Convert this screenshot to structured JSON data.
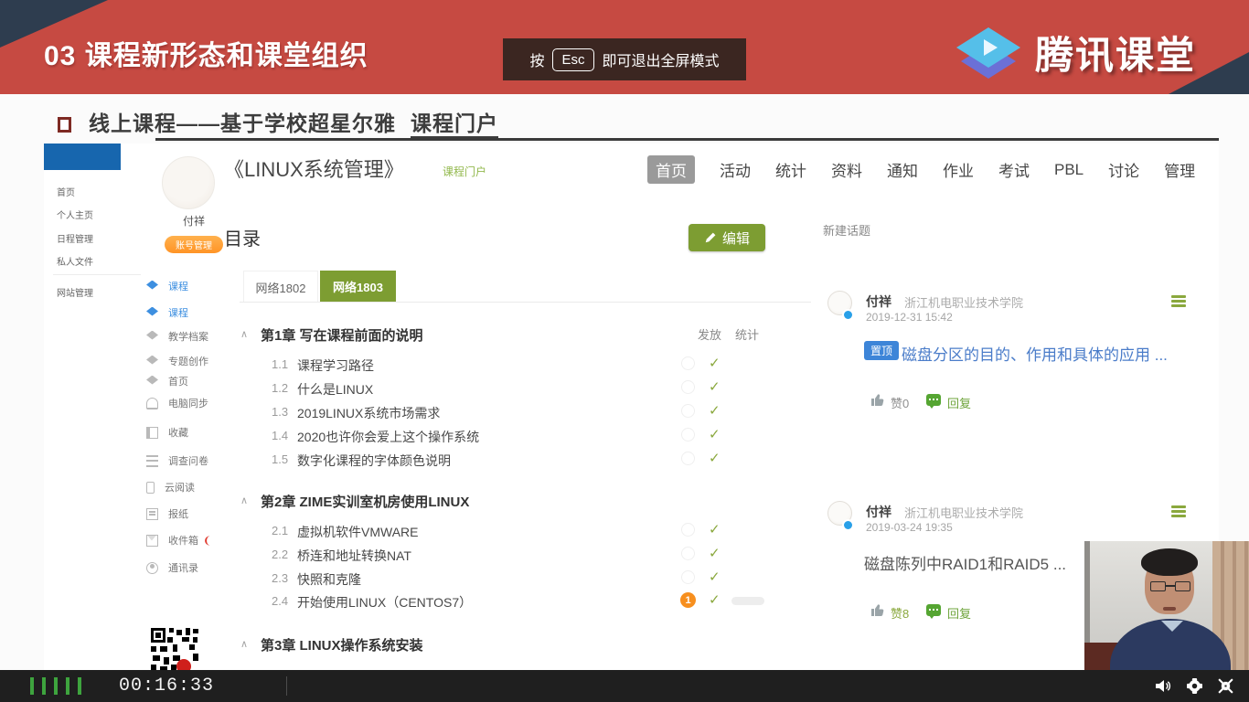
{
  "banner": {
    "title": "03 课程新形态和课堂组织",
    "esc_prefix": "按",
    "esc_key": "Esc",
    "esc_suffix": "即可退出全屏模式",
    "logo_text": "腾讯课堂"
  },
  "slide": {
    "heading": "线上课程——基于学校超星尔雅",
    "heading_link": "课程门户"
  },
  "portal": {
    "primary_nav": [
      "首页",
      "个人主页",
      "日程管理",
      "私人文件",
      "网站管理"
    ],
    "profile": {
      "name": "付祥",
      "badge": "账号管理"
    },
    "secondary_nav": [
      {
        "label": "课程",
        "icon": "cap"
      },
      {
        "label": "课程",
        "icon": "cap"
      },
      {
        "label": "教学档案",
        "icon": "cap"
      },
      {
        "label": "专题创作",
        "icon": "cap"
      },
      {
        "label": "首页",
        "icon": "cap"
      },
      {
        "label": "电脑同步",
        "icon": "cloud"
      },
      {
        "label": "收藏",
        "icon": "book"
      },
      {
        "label": "调查问卷",
        "icon": "list"
      },
      {
        "label": "云阅读",
        "icon": "phone"
      },
      {
        "label": "报纸",
        "icon": "newspaper"
      },
      {
        "label": "收件箱",
        "icon": "mail"
      },
      {
        "label": "通讯录",
        "icon": "person"
      }
    ],
    "course": {
      "title": "《LINUX系统管理》",
      "subtitle": "课程门户"
    },
    "tabs": [
      "首页",
      "活动",
      "统计",
      "资料",
      "通知",
      "作业",
      "考试",
      "PBL",
      "讨论",
      "管理"
    ],
    "toc": {
      "heading": "目录",
      "edit_label": "编辑",
      "class_tabs": [
        "网络1802",
        "网络1803"
      ],
      "columns": [
        "发放",
        "统计"
      ],
      "chapters": [
        {
          "title": "第1章 写在课程前面的说明"
        },
        {
          "title": "第2章 ZIME实训室机房使用LINUX"
        },
        {
          "title": "第3章 LINUX操作系统安装"
        }
      ],
      "sections": [
        {
          "no": "1.1",
          "title": "课程学习路径"
        },
        {
          "no": "1.2",
          "title": "什么是LINUX"
        },
        {
          "no": "1.3",
          "title": "2019LINUX系统市场需求"
        },
        {
          "no": "1.4",
          "title": "2020也许你会爱上这个操作系统"
        },
        {
          "no": "1.5",
          "title": "数字化课程的字体颜色说明"
        },
        {
          "no": "2.1",
          "title": "虚拟机软件VMWARE"
        },
        {
          "no": "2.2",
          "title": "桥连和地址转换NAT"
        },
        {
          "no": "2.3",
          "title": "快照和克隆"
        },
        {
          "no": "2.4",
          "title": "开始使用LINUX（CENTOS7）",
          "badge": "1"
        }
      ]
    },
    "discussion": {
      "new_topic": "新建话题",
      "posts": [
        {
          "author": "付祥",
          "org": "浙江机电职业技术学院",
          "time": "2019-12-31 15:42",
          "pin": "置顶",
          "title": "磁盘分区的目的、作用和具体的应用 ...",
          "likes": "赞0",
          "reply": "回复"
        },
        {
          "author": "付祥",
          "org": "浙江机电职业技术学院",
          "time": "2019-03-24 19:35",
          "title": "磁盘陈列中RAID1和RAID5 ...",
          "likes": "赞8",
          "reply": "回复"
        }
      ]
    }
  },
  "player": {
    "time": "00:16:33"
  },
  "colors": {
    "banner_red": "#c64a42",
    "corner_navy": "#2e3d4f",
    "accent_olive": "#7d9d32",
    "check_green": "#8aa83d",
    "link_blue": "#4a7cc9",
    "pin_blue": "#3d85d8",
    "badge_orange": "#f78f1e",
    "tab_active_gray": "#9a9a9a",
    "signal_green": "#3ea43e"
  }
}
